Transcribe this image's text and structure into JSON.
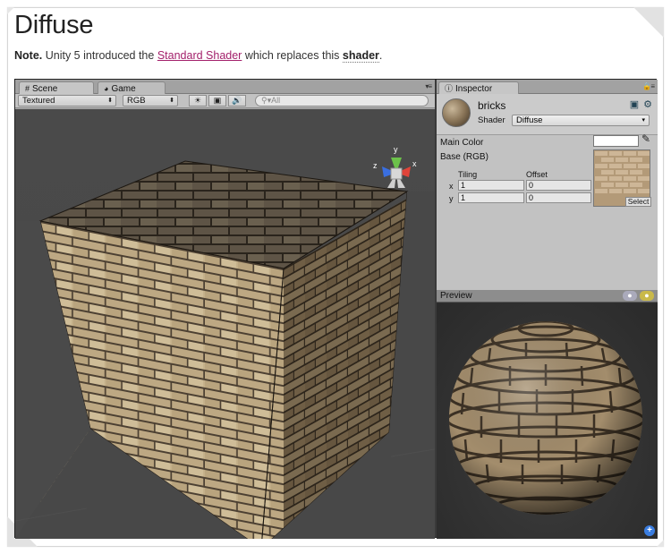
{
  "page": {
    "title": "Diffuse",
    "note_label": "Note.",
    "note_before": "Unity 5 introduced the",
    "note_link": "Standard Shader",
    "note_middle": "which replaces this",
    "note_term": "shader",
    "note_end": "."
  },
  "scene": {
    "tabs": [
      {
        "label": "Scene",
        "icon": "hash-icon"
      },
      {
        "label": "Game",
        "icon": "pacman-icon"
      }
    ],
    "toolbar": {
      "draw_mode": "Textured",
      "channel": "RGB",
      "search_placeholder": "All"
    },
    "gizmo": {
      "x": "x",
      "y": "y",
      "z": "z"
    }
  },
  "inspector": {
    "tab": "Inspector",
    "material_name": "bricks",
    "shader_label": "Shader",
    "shader_value": "Diffuse",
    "main_color_label": "Main Color",
    "main_color_value": "#ffffff",
    "base_label": "Base (RGB)",
    "tiling_label": "Tiling",
    "offset_label": "Offset",
    "x_label": "x",
    "y_label": "y",
    "tiling_x": "1",
    "tiling_y": "1",
    "offset_x": "0",
    "offset_y": "0",
    "select_label": "Select"
  },
  "preview": {
    "title": "Preview"
  },
  "colors": {
    "link": "#a3206b",
    "brick_light": "#c8b48f",
    "brick_dark": "#6e5b42",
    "mortar": "#4a3e30"
  }
}
